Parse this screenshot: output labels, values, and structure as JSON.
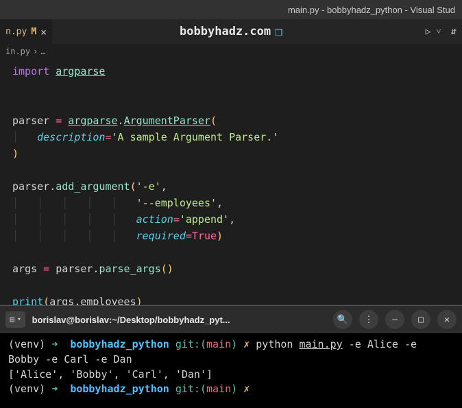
{
  "window": {
    "title": "main.py - bobbyhadz_python - Visual Stud"
  },
  "tab": {
    "filename": "n.py",
    "modified": "M",
    "close": "×"
  },
  "site": {
    "label": "bobbyhadz.com"
  },
  "breadcrumb": {
    "file": "in.py",
    "separator": "›",
    "ellipsis": "…"
  },
  "code": {
    "l1_import": "import",
    "l1_mod": "argparse",
    "l3_var": "parser",
    "l3_eq": "=",
    "l3_mod": "argparse",
    "l3_dot": ".",
    "l3_class": "ArgumentParser",
    "l3_open": "(",
    "l4_param": "description",
    "l4_eq": "=",
    "l4_str": "'A sample Argument Parser.'",
    "l5_close": ")",
    "l7_var": "parser",
    "l7_dot": ".",
    "l7_method": "add_argument",
    "l7_open": "(",
    "l7_str1": "'-e'",
    "l7_comma": ",",
    "l8_str": "'--employees'",
    "l8_comma": ",",
    "l9_param": "action",
    "l9_eq": "=",
    "l9_str": "'append'",
    "l9_comma": ",",
    "l10_param": "required",
    "l10_eq": "=",
    "l10_true": "True",
    "l10_close": ")",
    "l12_args": "args",
    "l12_eq": "=",
    "l12_var": "parser",
    "l12_dot": ".",
    "l12_method": "parse_args",
    "l12_parens": "()",
    "l14_print": "print",
    "l14_open": "(",
    "l14_args": "args",
    "l14_dot": ".",
    "l14_prop": "employees",
    "l14_close": ")"
  },
  "terminal": {
    "path_label": "borislav@borislav:~/Desktop/bobbyhadz_pyt...",
    "venv": "(venv)",
    "arrow": "➜",
    "dir": "bobbyhadz_python",
    "git": "git:",
    "git_open": "(",
    "branch": "main",
    "git_close": ")",
    "lightning": "✗",
    "cmd_python": "python",
    "cmd_file": "main.py",
    "cmd_args": "-e Alice -e Bobby -e Carl -e Dan",
    "cmd_e": "-e",
    "output": "['Alice', 'Bobby', 'Carl', 'Dan']"
  }
}
